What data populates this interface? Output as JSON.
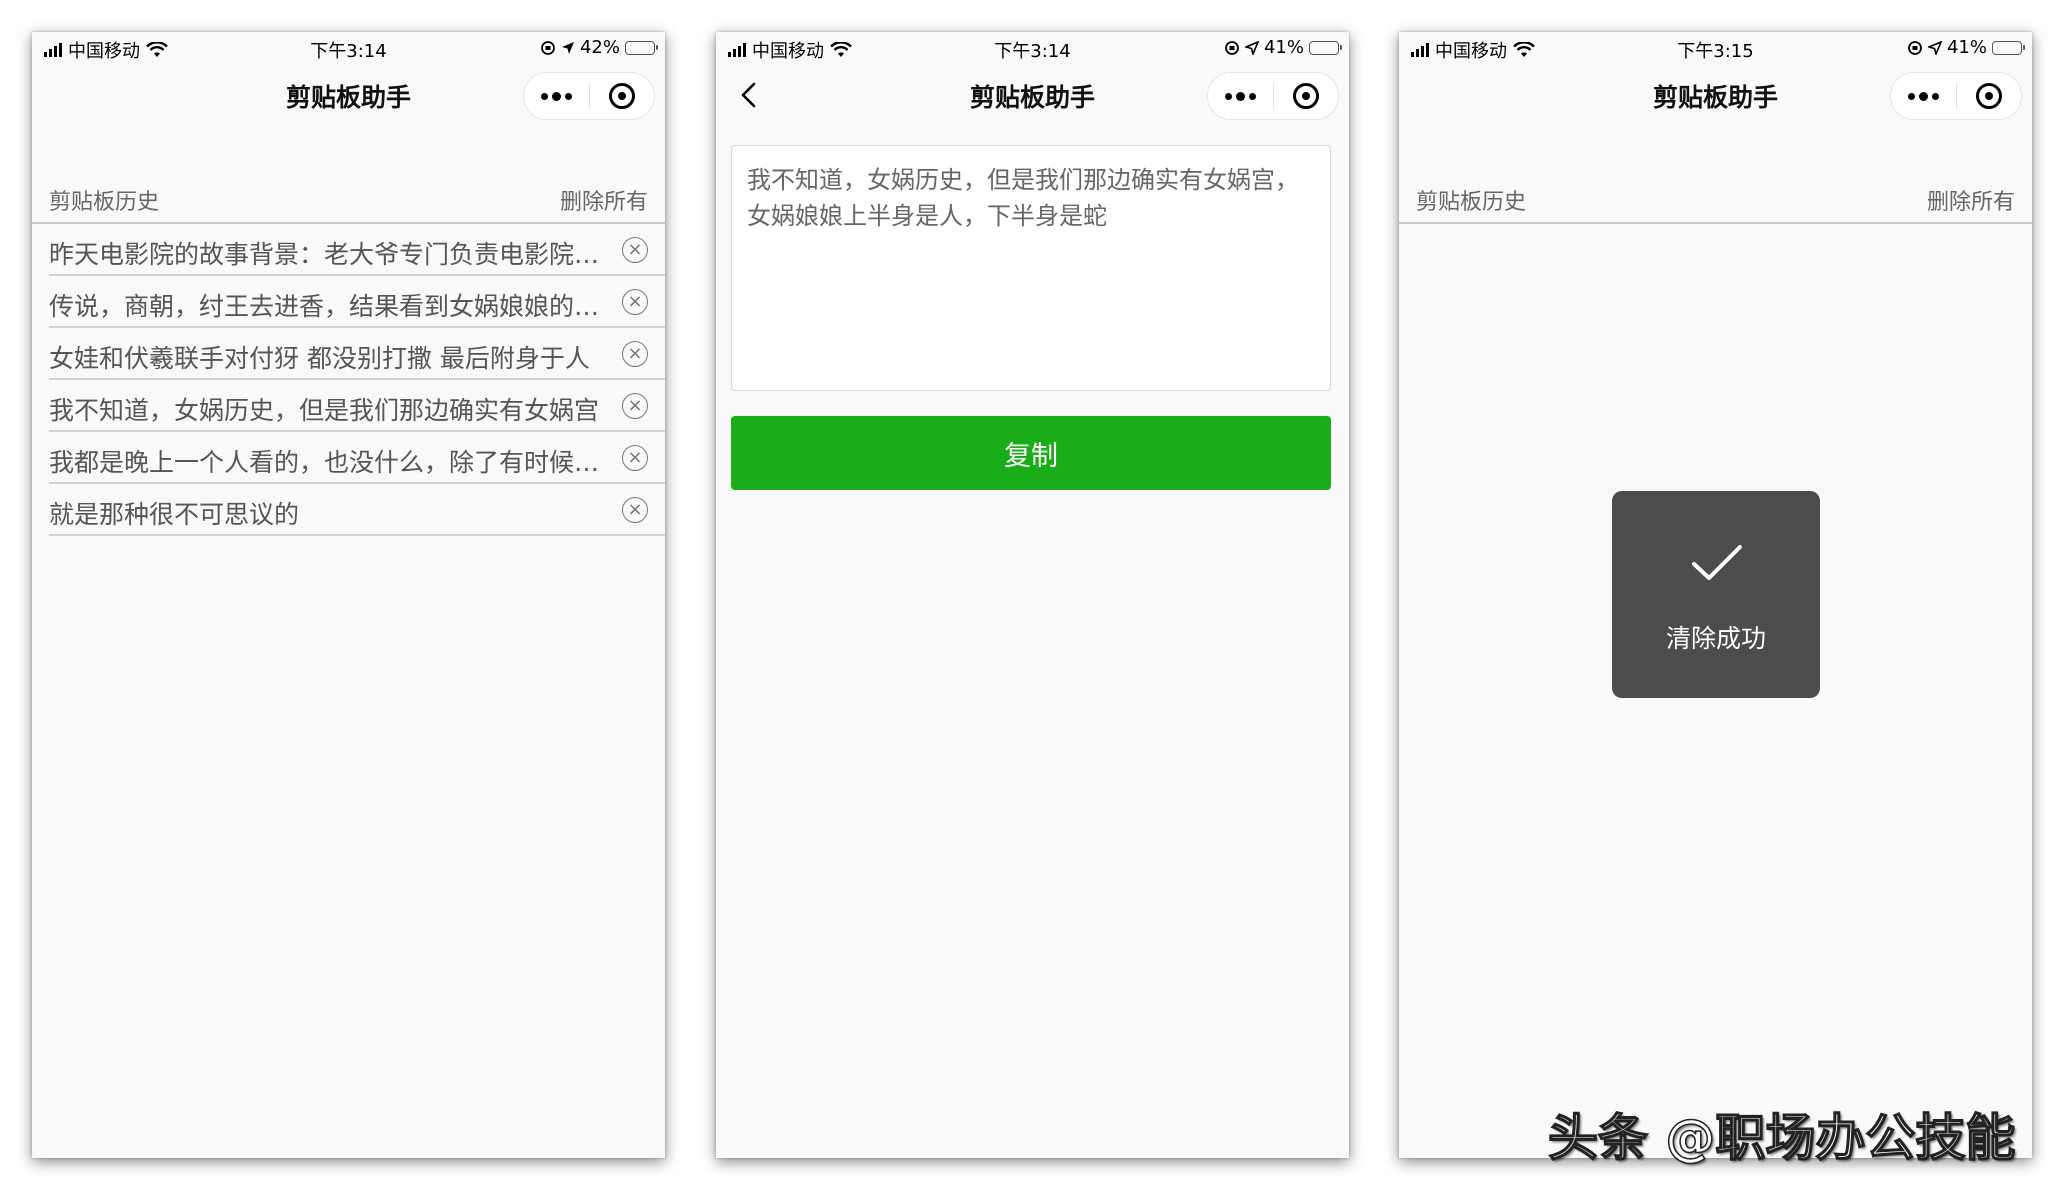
{
  "app_title": "剪贴板助手",
  "screens": [
    {
      "status": {
        "carrier": "中国移动",
        "time": "下午3:14",
        "battery": "42%"
      },
      "list_header": {
        "title": "剪贴板历史",
        "action": "删除所有"
      },
      "history": [
        "昨天电影院的故事背景：老大爷专门负责电影院的清洁工作",
        "传说，商朝，纣王去进香，结果看到女娲娘娘的神像",
        "女娃和伏羲联手对付犽 都没别打撒 最后附身于人",
        "我不知道，女娲历史，但是我们那边确实有女娲宫",
        "我都是晚上一个人看的，也没什么，除了有时候有点怕",
        "就是那种很不可思议的"
      ]
    },
    {
      "status": {
        "carrier": "中国移动",
        "time": "下午3:14",
        "battery": "41%"
      },
      "textarea_value": "我不知道，女娲历史，但是我们那边确实有女娲宫，女娲娘娘上半身是人，下半身是蛇",
      "copy_label": "复制"
    },
    {
      "status": {
        "carrier": "中国移动",
        "time": "下午3:15",
        "battery": "41%"
      },
      "list_header": {
        "title": "剪贴板历史",
        "action": "删除所有"
      },
      "toast_text": "清除成功"
    }
  ],
  "watermark": "头条 @职场办公技能",
  "colors": {
    "primary_green": "#1aad19",
    "toast_bg": "#4c4c4c"
  }
}
